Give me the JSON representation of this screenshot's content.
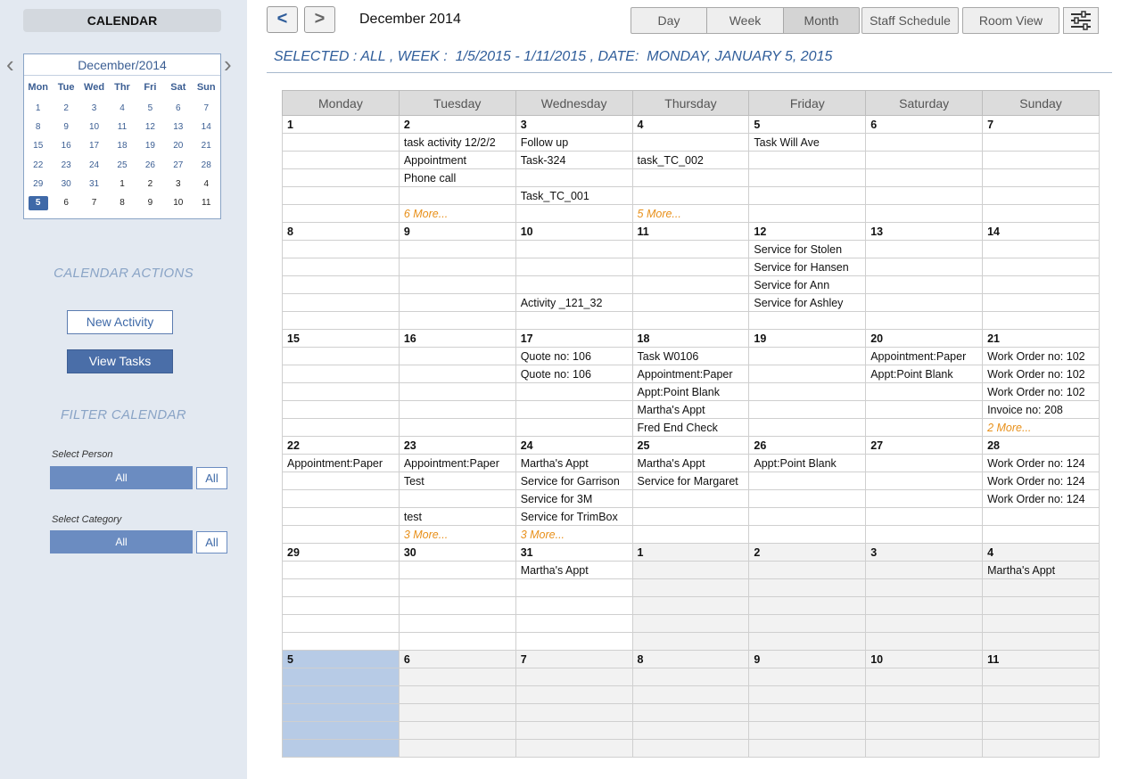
{
  "sidebar": {
    "title": "CALENDAR",
    "mini": {
      "month_label": "December/2014",
      "dow": [
        "Mon",
        "Tue",
        "Wed",
        "Thr",
        "Fri",
        "Sat",
        "Sun"
      ],
      "weeks": [
        [
          "1",
          "2",
          "3",
          "4",
          "5",
          "6",
          "7"
        ],
        [
          "8",
          "9",
          "10",
          "11",
          "12",
          "13",
          "14"
        ],
        [
          "15",
          "16",
          "17",
          "18",
          "19",
          "20",
          "21"
        ],
        [
          "22",
          "23",
          "24",
          "25",
          "26",
          "27",
          "28"
        ],
        [
          "29",
          "30",
          "31",
          "1",
          "2",
          "3",
          "4"
        ],
        [
          "5",
          "6",
          "7",
          "8",
          "9",
          "10",
          "11"
        ]
      ],
      "selected": "5"
    },
    "actions_title": "CALENDAR ACTIONS",
    "new_activity": "New Activity",
    "view_tasks": "View Tasks",
    "filter_title": "FILTER CALENDAR",
    "person_label": "Select Person",
    "person_value": "All",
    "person_all": "All",
    "category_label": "Select Category",
    "category_value": "All",
    "category_all": "All"
  },
  "toolbar": {
    "prev": "<",
    "next": ">",
    "title": "December 2014",
    "views": [
      "Day",
      "Week",
      "Month"
    ],
    "active_view": "Month",
    "staff_schedule": "Staff Schedule",
    "room_view": "Room View"
  },
  "selected_line": "SELECTED : ALL , WEEK :  1/5/2015 - 1/11/2015 , DATE:  MONDAY, JANUARY 5, 2015",
  "colors": {
    "accent": "#3f69a8",
    "more": "#e8901a",
    "selected_day": "#b7cbe6"
  },
  "calendar": {
    "days": [
      "Monday",
      "Tuesday",
      "Wednesday",
      "Thursday",
      "Friday",
      "Saturday",
      "Sunday"
    ],
    "weeks": [
      {
        "dates": [
          "1",
          "2",
          "3",
          "4",
          "5",
          "6",
          "7"
        ],
        "rows": [
          [
            "",
            "task activity 12/2/2",
            "Follow up",
            "",
            "Task Will Ave",
            "",
            ""
          ],
          [
            "",
            "Appointment",
            "Task-324",
            "task_TC_002",
            "",
            "",
            ""
          ],
          [
            "",
            "Phone call",
            "",
            "",
            "",
            "",
            ""
          ],
          [
            "",
            "",
            "Task_TC_001",
            "",
            "",
            "",
            ""
          ],
          [
            "",
            "6 More...",
            "",
            "5 More...",
            "",
            "",
            ""
          ]
        ]
      },
      {
        "dates": [
          "8",
          "9",
          "10",
          "11",
          "12",
          "13",
          "14"
        ],
        "rows": [
          [
            "",
            "",
            "",
            "",
            "Service for Stolen",
            "",
            ""
          ],
          [
            "",
            "",
            "",
            "",
            "Service for Hansen",
            "",
            ""
          ],
          [
            "",
            "",
            "",
            "",
            "Service for Ann",
            "",
            ""
          ],
          [
            "",
            "",
            "Activity _121_32",
            "",
            "Service for Ashley",
            "",
            ""
          ],
          [
            "",
            "",
            "",
            "",
            "",
            "",
            ""
          ]
        ]
      },
      {
        "dates": [
          "15",
          "16",
          "17",
          "18",
          "19",
          "20",
          "21"
        ],
        "rows": [
          [
            "",
            "",
            "Quote no: 106",
            "Task W0106",
            "",
            "Appointment:Paper",
            "Work Order no: 102"
          ],
          [
            "",
            "",
            "Quote no: 106",
            "Appointment:Paper",
            "",
            "Appt:Point Blank",
            "Work Order no: 102"
          ],
          [
            "",
            "",
            "",
            "Appt:Point Blank",
            "",
            "",
            "Work Order no: 102"
          ],
          [
            "",
            "",
            "",
            "Martha's Appt",
            "",
            "",
            "Invoice no: 208"
          ],
          [
            "",
            "",
            "",
            "Fred End Check",
            "",
            "",
            "2 More..."
          ]
        ]
      },
      {
        "dates": [
          "22",
          "23",
          "24",
          "25",
          "26",
          "27",
          "28"
        ],
        "rows": [
          [
            "Appointment:Paper",
            "Appointment:Paper",
            "Martha's Appt",
            "Martha's Appt",
            "Appt:Point Blank",
            "",
            "Work Order no: 124"
          ],
          [
            "",
            "Test",
            "Service for Garrison",
            "Service for Margaret",
            "",
            "",
            "Work Order no: 124"
          ],
          [
            "",
            "",
            "Service for 3M",
            "",
            "",
            "",
            "Work Order no: 124"
          ],
          [
            "",
            "test",
            "Service for TrimBox",
            "",
            "",
            "",
            ""
          ],
          [
            "",
            "3 More...",
            "3 More...",
            "",
            "",
            "",
            ""
          ]
        ]
      },
      {
        "dates": [
          "29",
          "30",
          "31",
          "1",
          "2",
          "3",
          "4"
        ],
        "rows": [
          [
            "",
            "",
            "Martha's Appt",
            "",
            "",
            "",
            "Martha's Appt"
          ],
          [
            "",
            "",
            "",
            "",
            "",
            "",
            ""
          ],
          [
            "",
            "",
            "",
            "",
            "",
            "",
            ""
          ],
          [
            "",
            "",
            "",
            "",
            "",
            "",
            ""
          ],
          [
            "",
            "",
            "",
            "",
            "",
            "",
            ""
          ]
        ]
      },
      {
        "dates": [
          "5",
          "6",
          "7",
          "8",
          "9",
          "10",
          "11"
        ],
        "rows": [
          [
            "",
            "",
            "",
            "",
            "",
            "",
            ""
          ],
          [
            "",
            "",
            "",
            "",
            "",
            "",
            ""
          ],
          [
            "",
            "",
            "",
            "",
            "",
            "",
            ""
          ],
          [
            "",
            "",
            "",
            "",
            "",
            "",
            ""
          ],
          [
            "",
            "",
            "",
            "",
            "",
            "",
            ""
          ]
        ]
      }
    ]
  }
}
